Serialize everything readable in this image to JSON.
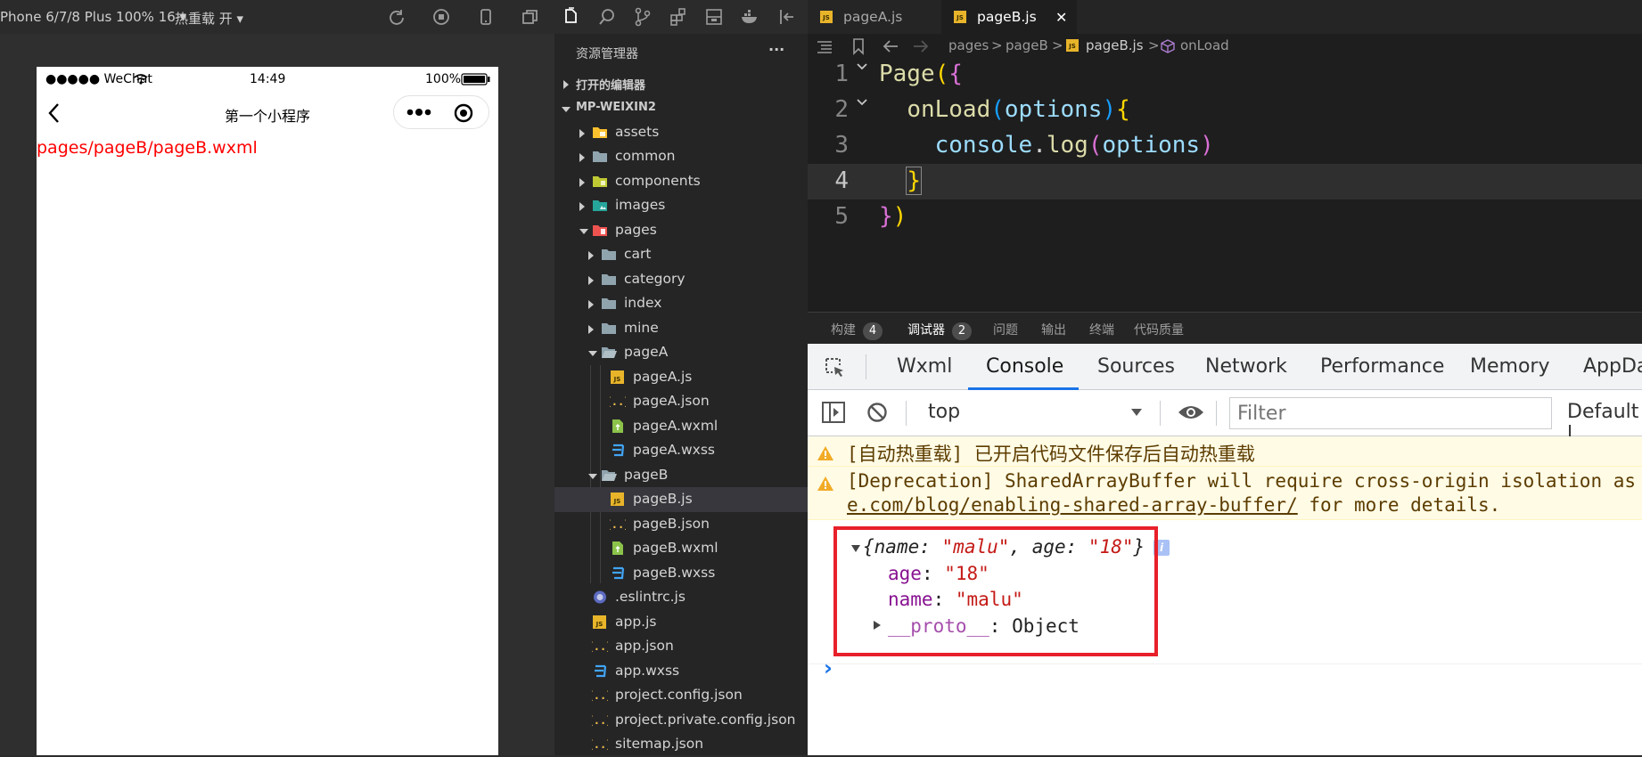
{
  "simulator": {
    "toolbar": {
      "device": "Phone 6/7/8 Plus 100% 16",
      "hot_reload": "热重载 开"
    },
    "status_bar": {
      "carrier": "●●●●● WeChat",
      "time": "14:49",
      "battery": "100%"
    },
    "nav_title": "第一个小程序",
    "page_path": "pages/pageB/pageB.wxml"
  },
  "explorer": {
    "title": "资源管理器",
    "more": "···",
    "open_editors": "打开的编辑器",
    "project": "MP-WEIXIN2",
    "items": [
      {
        "label": "assets"
      },
      {
        "label": "common"
      },
      {
        "label": "components"
      },
      {
        "label": "images"
      },
      {
        "label": "pages"
      },
      {
        "label": "cart"
      },
      {
        "label": "category"
      },
      {
        "label": "index"
      },
      {
        "label": "mine"
      },
      {
        "label": "pageA"
      },
      {
        "label": "pageA.js"
      },
      {
        "label": "pageA.json"
      },
      {
        "label": "pageA.wxml"
      },
      {
        "label": "pageA.wxss"
      },
      {
        "label": "pageB"
      },
      {
        "label": "pageB.js"
      },
      {
        "label": "pageB.json"
      },
      {
        "label": "pageB.wxml"
      },
      {
        "label": "pageB.wxss"
      },
      {
        "label": ".eslintrc.js"
      },
      {
        "label": "app.js"
      },
      {
        "label": "app.json"
      },
      {
        "label": "app.wxss"
      },
      {
        "label": "project.config.json"
      },
      {
        "label": "project.private.config.json"
      },
      {
        "label": "sitemap.json"
      }
    ],
    "icon_js": "JS"
  },
  "editor": {
    "tabs": [
      {
        "label": "pageA.js"
      },
      {
        "label": "pageB.js"
      }
    ],
    "close_glyph": "✕",
    "breadcrumb": {
      "part1": "pages",
      "part2": "pageB",
      "part3": "pageB.js",
      "part4": "onLoad",
      "sep": ">"
    },
    "line_numbers": [
      "1",
      "2",
      "3",
      "4",
      "5"
    ],
    "code": {
      "l1_fn": "Page",
      "l1_paren": "(",
      "l1_brace": "{",
      "l2_fn": "onLoad",
      "l2_paren_open": "(",
      "l2_arg": "options",
      "l2_paren_close": ")",
      "l2_brace": "{",
      "l3_obj": "console",
      "l3_dot": ".",
      "l3_fn": "log",
      "l3_paren_open": "(",
      "l3_arg": "options",
      "l3_paren_close": ")",
      "l4_brace": "}",
      "l5_brace": "}",
      "l5_paren": ")"
    }
  },
  "panel": {
    "tabs": [
      {
        "label": "构建",
        "count": "4"
      },
      {
        "label": "调试器",
        "count": "2"
      },
      {
        "label": "问题"
      },
      {
        "label": "输出"
      },
      {
        "label": "终端"
      },
      {
        "label": "代码质量"
      }
    ]
  },
  "devtools": {
    "tabs": [
      "Wxml",
      "Console",
      "Sources",
      "Network",
      "Performance",
      "Memory",
      "AppDa"
    ],
    "context": "top",
    "filter_placeholder": "Filter",
    "levels": "Default l",
    "messages": {
      "warn1": "[自动热重载] 已开启代码文件保存后自动热重载",
      "warn2_line1": "[Deprecation] SharedArrayBuffer will require cross-origin isolation as o",
      "warn2_link": "e.com/blog/enabling-shared-array-buffer/",
      "warn2_rest": " for more details."
    },
    "object": {
      "summary_open": "{",
      "k_name": "name",
      "v_name": "\"malu\"",
      "k_age": "age",
      "v_age": "\"18\"",
      "summary_close": "}",
      "colon": ": ",
      "comma": ", ",
      "info": "i",
      "proto_key": "__proto__",
      "proto_val": "Object"
    },
    "prompt": "›"
  },
  "colors": {
    "accent": "#1a73e8",
    "highlight_box": "#e8202a",
    "warning_bg": "#fffbe5",
    "page_path_red": "#ff0000"
  }
}
